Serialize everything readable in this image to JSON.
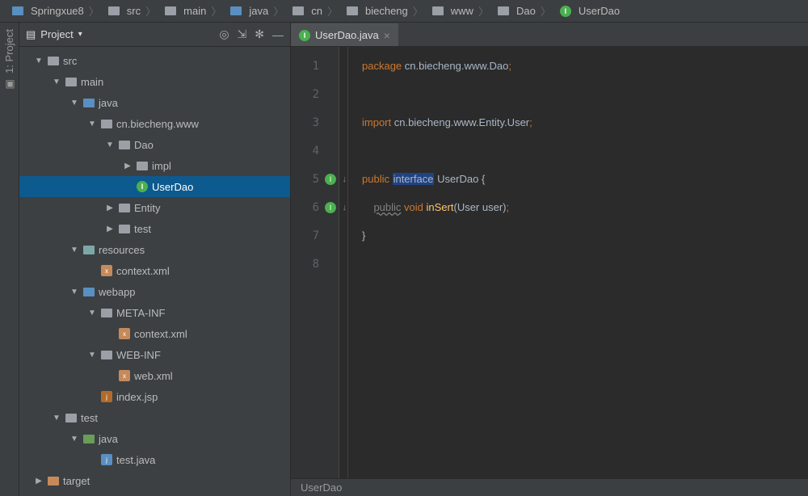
{
  "breadcrumb": [
    {
      "icon": "project",
      "label": "Springxue8"
    },
    {
      "icon": "folder",
      "label": "src"
    },
    {
      "icon": "folder",
      "label": "main"
    },
    {
      "icon": "folder-blue",
      "label": "java"
    },
    {
      "icon": "folder",
      "label": "cn"
    },
    {
      "icon": "folder",
      "label": "biecheng"
    },
    {
      "icon": "folder",
      "label": "www"
    },
    {
      "icon": "folder",
      "label": "Dao"
    },
    {
      "icon": "interface",
      "label": "UserDao"
    }
  ],
  "left_gutter": {
    "label": "1: Project"
  },
  "project": {
    "title": "Project",
    "tree": [
      {
        "depth": 0,
        "arrow": "down",
        "icon": "folder",
        "label": "src"
      },
      {
        "depth": 1,
        "arrow": "down",
        "icon": "folder",
        "label": "main"
      },
      {
        "depth": 2,
        "arrow": "down",
        "icon": "folder-blue",
        "label": "java"
      },
      {
        "depth": 3,
        "arrow": "down",
        "icon": "folder",
        "label": "cn.biecheng.www"
      },
      {
        "depth": 4,
        "arrow": "down",
        "icon": "folder",
        "label": "Dao"
      },
      {
        "depth": 5,
        "arrow": "right",
        "icon": "folder",
        "label": "impl"
      },
      {
        "depth": 5,
        "arrow": "",
        "icon": "interface",
        "label": "UserDao",
        "selected": true
      },
      {
        "depth": 4,
        "arrow": "right",
        "icon": "folder",
        "label": "Entity"
      },
      {
        "depth": 4,
        "arrow": "right",
        "icon": "folder",
        "label": "test"
      },
      {
        "depth": 2,
        "arrow": "down",
        "icon": "folder-teal",
        "label": "resources"
      },
      {
        "depth": 3,
        "arrow": "",
        "icon": "xml",
        "label": "context.xml"
      },
      {
        "depth": 2,
        "arrow": "down",
        "icon": "folder-blue",
        "label": "webapp"
      },
      {
        "depth": 3,
        "arrow": "down",
        "icon": "folder",
        "label": "META-INF"
      },
      {
        "depth": 4,
        "arrow": "",
        "icon": "xml",
        "label": "context.xml"
      },
      {
        "depth": 3,
        "arrow": "down",
        "icon": "folder",
        "label": "WEB-INF"
      },
      {
        "depth": 4,
        "arrow": "",
        "icon": "xml",
        "label": "web.xml"
      },
      {
        "depth": 3,
        "arrow": "",
        "icon": "jsp",
        "label": "index.jsp"
      },
      {
        "depth": 1,
        "arrow": "down",
        "icon": "folder",
        "label": "test"
      },
      {
        "depth": 2,
        "arrow": "down",
        "icon": "folder-green",
        "label": "java"
      },
      {
        "depth": 3,
        "arrow": "",
        "icon": "java",
        "label": "test.java"
      },
      {
        "depth": 0,
        "arrow": "right",
        "icon": "folder-orange",
        "label": "target"
      }
    ]
  },
  "tab": {
    "label": "UserDao.java"
  },
  "code": {
    "lines": [
      {
        "n": 1,
        "segments": [
          {
            "t": "package ",
            "c": "kw-orange"
          },
          {
            "t": "cn.biecheng.www.Dao",
            "c": "kw-text"
          },
          {
            "t": ";",
            "c": "kw-orange"
          }
        ]
      },
      {
        "n": 2,
        "segments": []
      },
      {
        "n": 3,
        "segments": [
          {
            "t": "import ",
            "c": "kw-orange"
          },
          {
            "t": "cn.biecheng.www.Entity.User",
            "c": "kw-text"
          },
          {
            "t": ";",
            "c": "kw-orange"
          }
        ]
      },
      {
        "n": 4,
        "segments": []
      },
      {
        "n": 5,
        "mark": true,
        "segments": [
          {
            "t": "public ",
            "c": "kw-orange"
          },
          {
            "t": "interface",
            "c": "kw-sel"
          },
          {
            "t": " UserDao {",
            "c": "kw-text"
          }
        ]
      },
      {
        "n": 6,
        "mark": true,
        "segments": [
          {
            "t": "    ",
            "c": ""
          },
          {
            "t": "public",
            "c": "kw-gray"
          },
          {
            "t": " ",
            "c": ""
          },
          {
            "t": "void ",
            "c": "kw-orange"
          },
          {
            "t": "inSert",
            "c": "kw-yellow"
          },
          {
            "t": "(User user)",
            "c": "kw-text"
          },
          {
            "t": ";",
            "c": "kw-orange"
          }
        ]
      },
      {
        "n": 7,
        "segments": [
          {
            "t": "}",
            "c": "kw-text"
          }
        ]
      },
      {
        "n": 8,
        "segments": []
      }
    ]
  },
  "status": {
    "breadcrumb": "UserDao"
  }
}
